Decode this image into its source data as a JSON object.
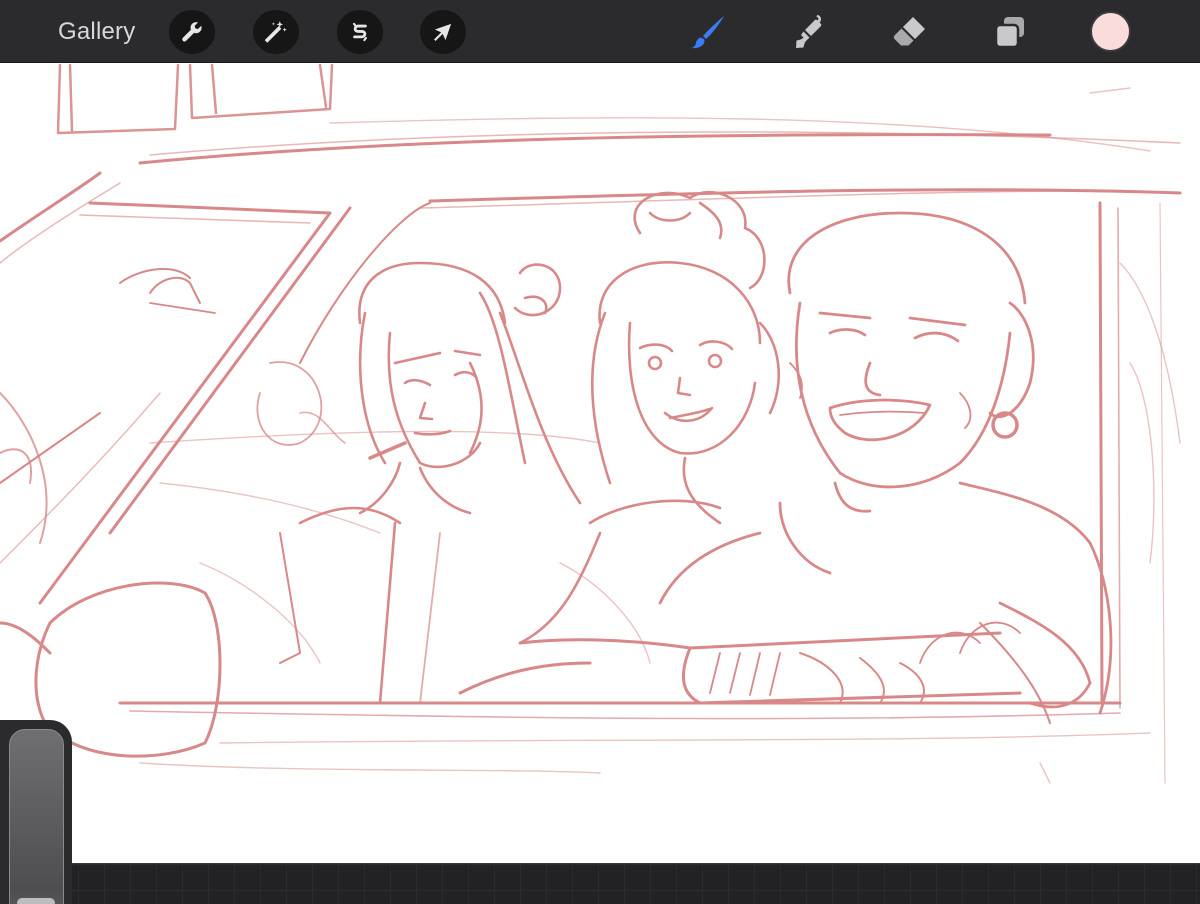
{
  "toolbar": {
    "gallery_label": "Gallery",
    "tools_left": [
      "wrench-icon",
      "magic-wand-icon",
      "selection-icon",
      "transform-arrow-icon"
    ],
    "tools_right": [
      "brush-icon",
      "smudge-icon",
      "eraser-icon",
      "layers-icon"
    ],
    "active_tool": "brush",
    "current_color": "#fadcdc",
    "active_tool_color": "#3b7cf5"
  },
  "canvas": {
    "sketch_color": "#d88888"
  }
}
